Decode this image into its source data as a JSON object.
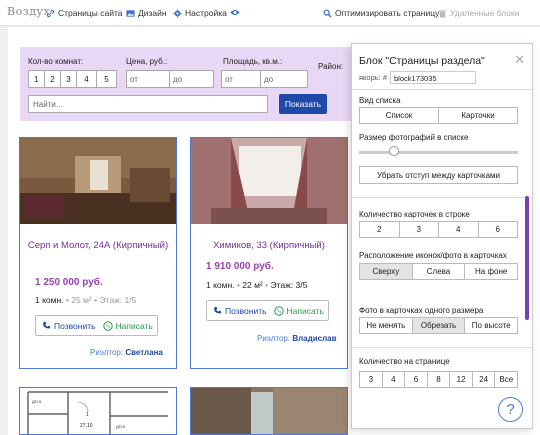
{
  "toolbar": {
    "logo": "Воздух",
    "pages": "Страницы сайта",
    "design": "Дизайн",
    "settings": "Настройка",
    "optimize": "Оптимизировать страницу",
    "deleted": "Удаленные блоки"
  },
  "filter": {
    "rooms_label": "Кол-во комнат:",
    "rooms": [
      "1",
      "2",
      "3",
      "4",
      "5"
    ],
    "price_label": "Цена, руб.:",
    "area_label": "Площадь, кв.м.:",
    "district_label": "Район:",
    "from": "от",
    "to": "до",
    "search_placeholder": "Найти...",
    "search_button": "Показать"
  },
  "cards": [
    {
      "title": "Серп и Молот, 24А (Кирпичный)",
      "price": "1 250 000 руб.",
      "rooms": "1 комн.",
      "area": "25 м²",
      "floor": "Этаж: 1/5",
      "call": "Позвонить",
      "write": "Написать",
      "realtor_label": "Риэлтор:",
      "realtor": "Светлана"
    },
    {
      "title": "Химиков, 33 (Кирпичный)",
      "price": "1 910 000 руб.",
      "rooms": "1 комн.",
      "area": "22 м²",
      "floor": "Этаж: 3/5",
      "call": "Позвонить",
      "write": "Написать",
      "realtor_label": "Риэлтор:",
      "realtor": "Владислав"
    }
  ],
  "floorplan": {
    "labels": [
      "1",
      "27,10",
      "ДП-9",
      "ДП-9"
    ]
  },
  "panel": {
    "title": "Блок \"Страницы раздела\"",
    "anchor_label": "якорь: #",
    "anchor_value": "block173035",
    "list_view_label": "Вид списка",
    "list_view": [
      "Список",
      "Карточки"
    ],
    "photo_size_label": "Размер фотографий в списке",
    "photo_size_value": 0.22,
    "remove_gap_button": "Убрать отступ между карточками",
    "per_row_label": "Количество карточек в строке",
    "per_row": [
      "2",
      "3",
      "4",
      "6"
    ],
    "icon_pos_label": "Расположение иконок/фото в карточках",
    "icon_pos": [
      "Сверху",
      "Слева",
      "На фоне"
    ],
    "icon_pos_selected": "Сверху",
    "same_size_label": "Фото в карточках одного размера",
    "same_size": [
      "Не менять",
      "Обрезать",
      "По высоте"
    ],
    "same_size_selected": "Обрезать",
    "per_page_label": "Количество на странице",
    "per_page": [
      "3",
      "4",
      "6",
      "8",
      "12",
      "24",
      "Все"
    ]
  },
  "help": "?",
  "colors": {
    "accent": "#1f49a8",
    "purple": "#9b3fb3",
    "filter_bg": "#e9d8f5",
    "card_border": "#4d7ad8",
    "whatsapp": "#2a9a4a"
  }
}
